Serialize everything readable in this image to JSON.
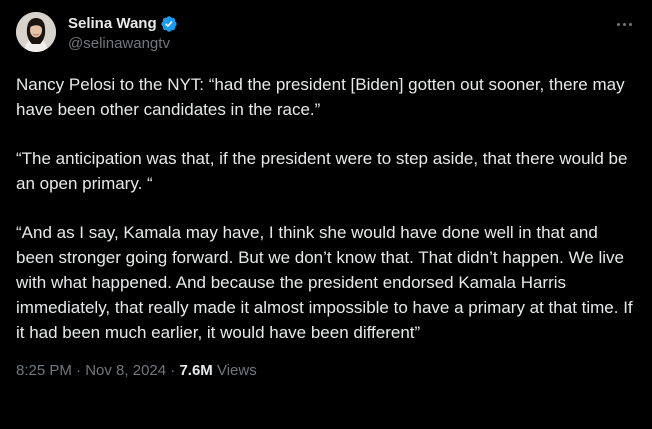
{
  "author": {
    "display_name": "Selina Wang",
    "handle": "@selinawangtv",
    "verified": true,
    "avatar_icon": "profile-photo",
    "verified_icon": "verified-badge-icon",
    "verified_color": "#1d9bf0"
  },
  "more_icon": "more-options-icon",
  "paragraphs": [
    "Nancy Pelosi to the NYT:  “had the president [Biden] gotten out sooner, there may have been other candidates in the race.”",
    "“The anticipation was that, if the president were to step aside, that there would be an open primary. “",
    "“And as I say, Kamala may have, I think she would have done well in that and been stronger going forward. But we don’t know that. That didn’t happen. We live with what happened. And because the president endorsed Kamala Harris immediately, that really made it almost impossible to have a primary at that time. If it had been much earlier, it would have been different”"
  ],
  "meta": {
    "time": "8:25 PM",
    "separator": " · ",
    "date": "Nov 8, 2024",
    "views_count": "7.6M",
    "views_label": " Views"
  },
  "colors": {
    "background": "#000000",
    "text": "#e7e9ea",
    "secondary_text": "#71767b"
  }
}
